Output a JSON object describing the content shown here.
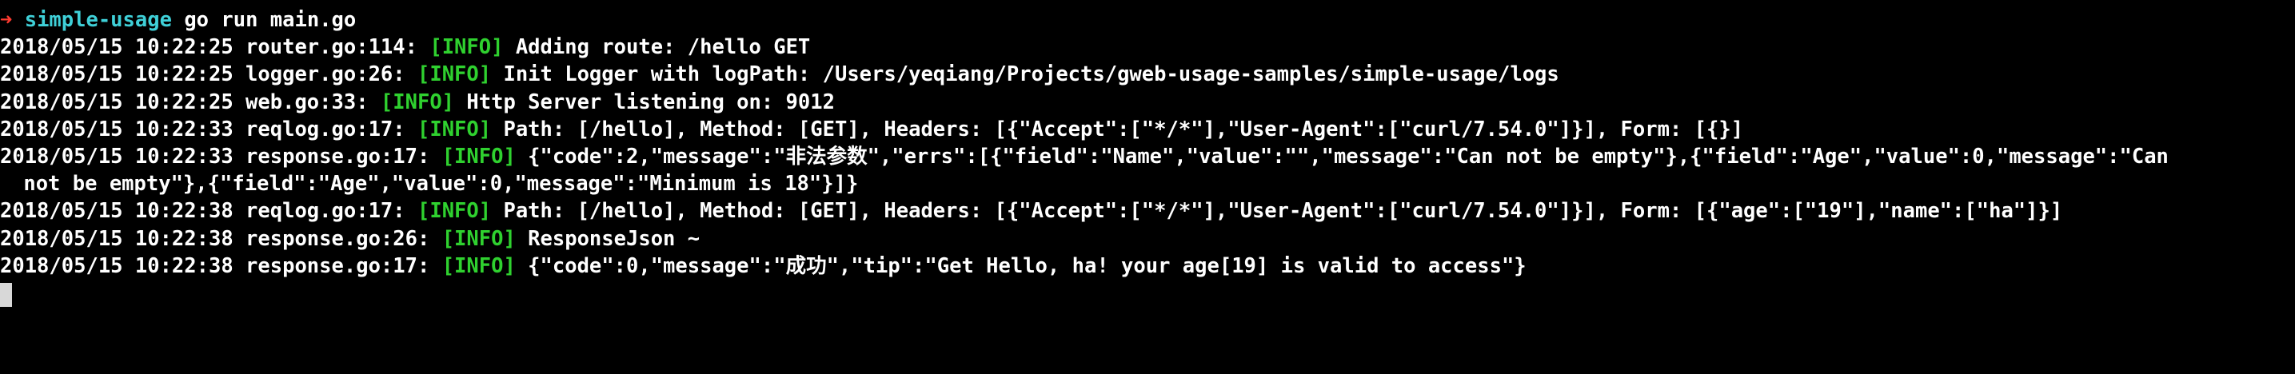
{
  "terminal": {
    "prompt": {
      "arrow": "➜",
      "directory": "simple-usage",
      "command": "go run main.go"
    },
    "lines": [
      {
        "prefix": "2018/05/15 10:22:25 router.go:114: ",
        "level": "[INFO]",
        "message": " Adding route: /hello GET"
      },
      {
        "prefix": "2018/05/15 10:22:25 logger.go:26: ",
        "level": "[INFO]",
        "message": " Init Logger with logPath: /Users/yeqiang/Projects/gweb-usage-samples/simple-usage/logs"
      },
      {
        "prefix": "2018/05/15 10:22:25 web.go:33: ",
        "level": "[INFO]",
        "message": " Http Server listening on: 9012"
      },
      {
        "prefix": "2018/05/15 10:22:33 reqlog.go:17: ",
        "level": "[INFO]",
        "message": " Path: [/hello], Method: [GET], Headers: [{\"Accept\":[\"*/*\"],\"User-Agent\":[\"curl/7.54.0\"]}], Form: [{}]"
      },
      {
        "prefix": "2018/05/15 10:22:33 response.go:17: ",
        "level": "[INFO]",
        "message": " {\"code\":2,\"message\":\"非法参数\",\"errs\":[{\"field\":\"Name\",\"value\":\"\",\"message\":\"Can not be empty\"},{\"field\":\"Age\",\"value\":0,\"message\":\"Can"
      },
      {
        "continuation": " not be empty\"},{\"field\":\"Age\",\"value\":0,\"message\":\"Minimum is 18\"}]}"
      },
      {
        "prefix": "2018/05/15 10:22:38 reqlog.go:17: ",
        "level": "[INFO]",
        "message": " Path: [/hello], Method: [GET], Headers: [{\"Accept\":[\"*/*\"],\"User-Agent\":[\"curl/7.54.0\"]}], Form: [{\"age\":[\"19\"],\"name\":[\"ha\"]}]"
      },
      {
        "prefix": "2018/05/15 10:22:38 response.go:26: ",
        "level": "[INFO]",
        "message": " ResponseJson ~"
      },
      {
        "prefix": "2018/05/15 10:22:38 response.go:17: ",
        "level": "[INFO]",
        "message": " {\"code\":0,\"message\":\"成功\",\"tip\":\"Get Hello, ha! your age[19] is valid to access\"}"
      }
    ],
    "colors": {
      "background": "#000000",
      "foreground": "#ffffff",
      "prompt_arrow": "#ff3b30",
      "prompt_directory": "#3fd0d8",
      "info_level": "#2fd12f",
      "cursor": "#d8d8d8"
    }
  }
}
